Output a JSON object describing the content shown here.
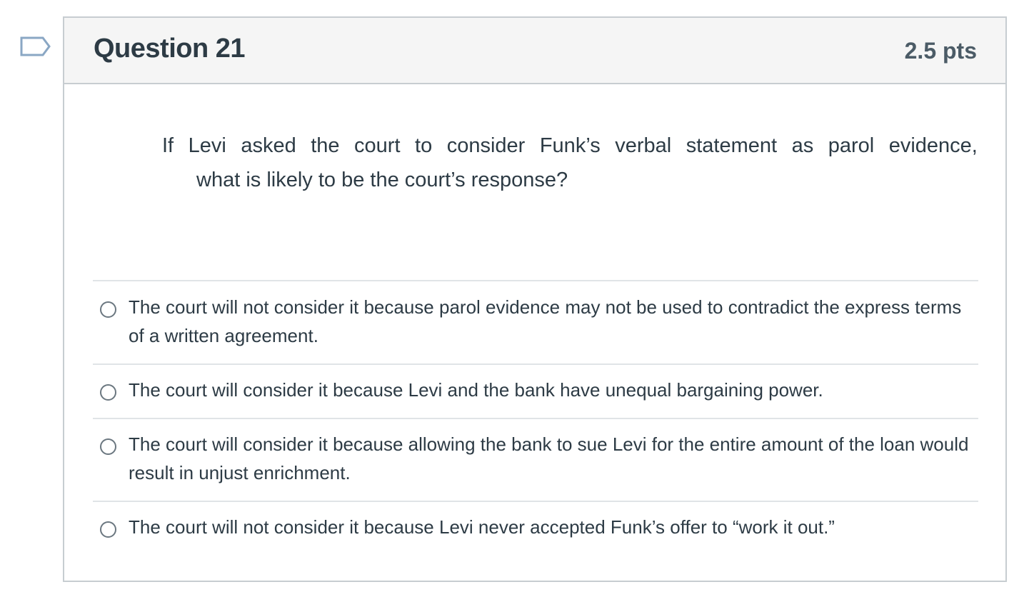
{
  "question": {
    "title": "Question 21",
    "points": "2.5 pts",
    "text_line1_words": [
      "If",
      "Levi",
      "asked",
      "the",
      "court",
      "to",
      "consider",
      "Funk’s",
      "verbal",
      "statement",
      "as",
      "parol",
      "evidence,"
    ],
    "text_line2": "what is likely to be the court’s response?"
  },
  "answers": [
    {
      "label": "The court will not consider it because parol evidence may not be used to contradict the express terms of a written agreement.",
      "selected": false
    },
    {
      "label": "The court will consider it because Levi and the bank have unequal bargaining power.",
      "selected": false
    },
    {
      "label": "The court will consider it because allowing the bank to sue Levi for the entire amount of the loan would result in unjust enrichment.",
      "selected": false
    },
    {
      "label": "The court will not consider it because Levi never accepted Funk’s offer to “work it out.”",
      "selected": false
    }
  ],
  "colors": {
    "header_bg": "#f5f5f5",
    "border": "#c7cdd1",
    "text": "#2d3b45",
    "flag": "#8aa7c4"
  },
  "icons": {
    "flag": "flag-question-icon",
    "radio": "radio-button-icon"
  }
}
